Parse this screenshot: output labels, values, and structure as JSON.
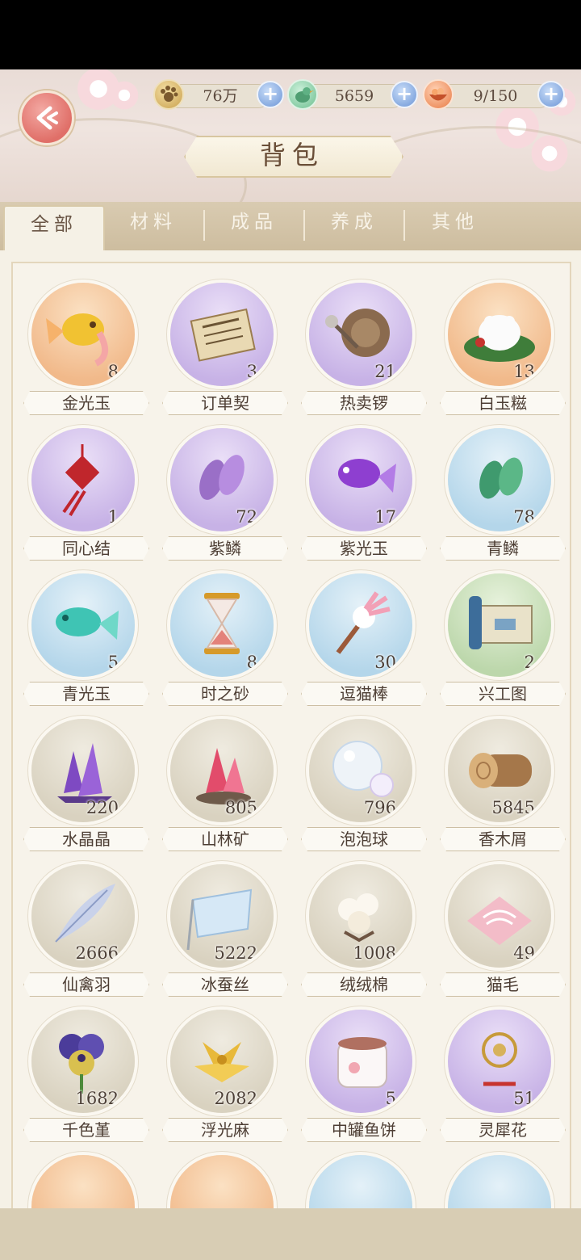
{
  "resources": [
    {
      "icon": "paw-coin-icon",
      "value": "76万"
    },
    {
      "icon": "jade-bird-icon",
      "value": "5659"
    },
    {
      "icon": "food-bowl-icon",
      "value": "9/150"
    }
  ],
  "header": {
    "title": "背包"
  },
  "tabs": [
    "全部",
    "材料",
    "成品",
    "养成",
    "其他"
  ],
  "items": [
    {
      "name": "金光玉",
      "count": "8",
      "bg": "orange",
      "art": "golden-fish-icon"
    },
    {
      "name": "订单契",
      "count": "3",
      "bg": "purple",
      "art": "contract-scroll-icon"
    },
    {
      "name": "热卖锣",
      "count": "21",
      "bg": "purple",
      "art": "gong-icon"
    },
    {
      "name": "白玉糍",
      "count": "13",
      "bg": "orange",
      "art": "rice-cake-icon"
    },
    {
      "name": "同心结",
      "count": "1",
      "bg": "purple",
      "art": "chinese-knot-icon"
    },
    {
      "name": "紫鳞",
      "count": "72",
      "bg": "purple",
      "art": "purple-scale-icon"
    },
    {
      "name": "紫光玉",
      "count": "17",
      "bg": "purple",
      "art": "purple-fish-icon"
    },
    {
      "name": "青鳞",
      "count": "78",
      "bg": "blue",
      "art": "green-scale-icon"
    },
    {
      "name": "青光玉",
      "count": "5",
      "bg": "blue",
      "art": "cyan-fish-icon"
    },
    {
      "name": "时之砂",
      "count": "8",
      "bg": "blue",
      "art": "hourglass-icon"
    },
    {
      "name": "逗猫棒",
      "count": "30",
      "bg": "blue",
      "art": "cat-teaser-icon"
    },
    {
      "name": "兴工图",
      "count": "2",
      "bg": "green",
      "art": "blueprint-scroll-icon"
    },
    {
      "name": "水晶晶",
      "count": "220",
      "bg": "beige",
      "art": "purple-crystal-icon"
    },
    {
      "name": "山林矿",
      "count": "805",
      "bg": "beige",
      "art": "red-ore-icon"
    },
    {
      "name": "泡泡球",
      "count": "796",
      "bg": "beige",
      "art": "bubble-icon"
    },
    {
      "name": "香木屑",
      "count": "5845",
      "bg": "beige",
      "art": "log-icon"
    },
    {
      "name": "仙禽羽",
      "count": "2666",
      "bg": "beige",
      "art": "feather-icon"
    },
    {
      "name": "冰蚕丝",
      "count": "5222",
      "bg": "beige",
      "art": "silk-cloth-icon"
    },
    {
      "name": "绒绒棉",
      "count": "1008",
      "bg": "beige",
      "art": "cotton-icon"
    },
    {
      "name": "猫毛",
      "count": "49",
      "bg": "beige",
      "art": "cat-fur-icon"
    },
    {
      "name": "千色堇",
      "count": "1682",
      "bg": "beige",
      "art": "pansy-icon"
    },
    {
      "name": "浮光麻",
      "count": "2082",
      "bg": "beige",
      "art": "golden-lily-icon"
    },
    {
      "name": "中罐鱼饼",
      "count": "5",
      "bg": "purple",
      "art": "fish-cake-jar-icon"
    },
    {
      "name": "灵犀花",
      "count": "51",
      "bg": "purple",
      "art": "gold-flower-icon"
    }
  ],
  "partial_row_bgs": [
    "orange",
    "orange",
    "blue",
    "blue"
  ]
}
